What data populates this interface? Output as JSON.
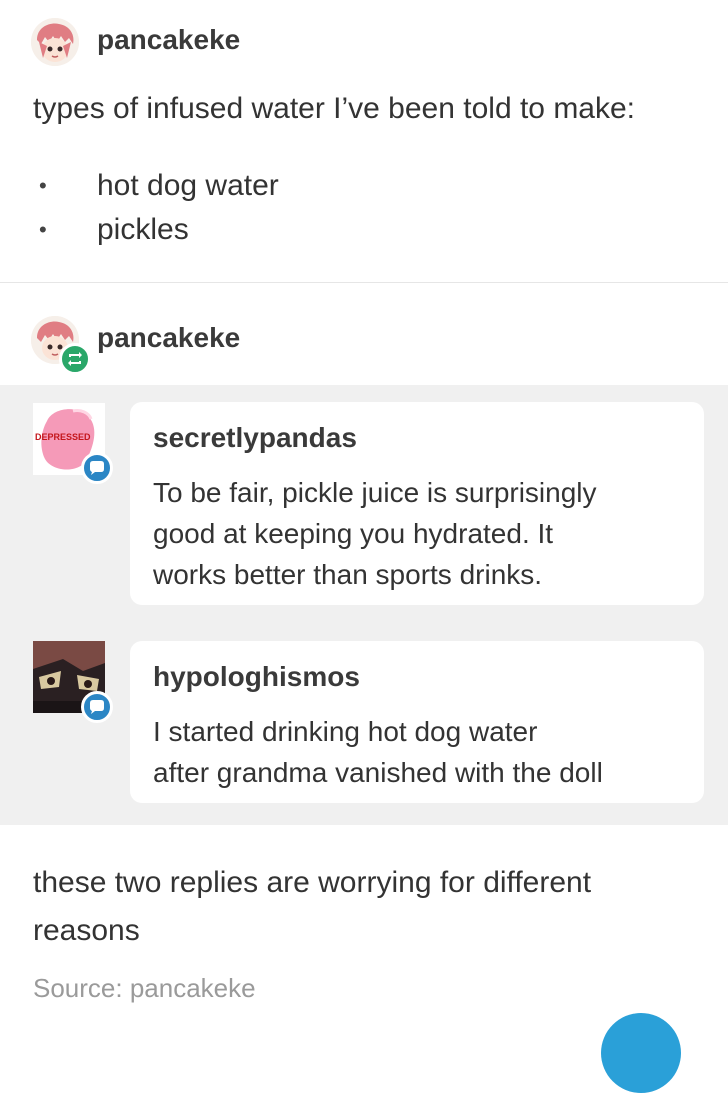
{
  "post": {
    "author": "pancakeke",
    "title": "types of infused water I’ve been told to make:",
    "items": [
      "hot dog water",
      "pickles"
    ]
  },
  "reblog": {
    "author": "pancakeke",
    "replies": [
      {
        "username": "secretlypandas",
        "text_lines": [
          "To be fair, pickle juice is surprisingly",
          "good at keeping you hydrated. It",
          "works better than sports drinks."
        ],
        "avatar_label": "DEPRESSED"
      },
      {
        "username": "hypologhismos",
        "text_lines": [
          "I started drinking hot dog water",
          "after grandma vanished with the doll"
        ]
      }
    ],
    "comment_lines": [
      "these two replies are worrying for different",
      "reasons"
    ],
    "source": "Source: pancakeke"
  },
  "colors": {
    "reblog_badge": "#2aa769",
    "reply_badge": "#2b86c5",
    "reply_background": "#f0f0f0"
  },
  "icons": [
    "user-avatar-icon",
    "reblog-icon",
    "reply-icon"
  ]
}
